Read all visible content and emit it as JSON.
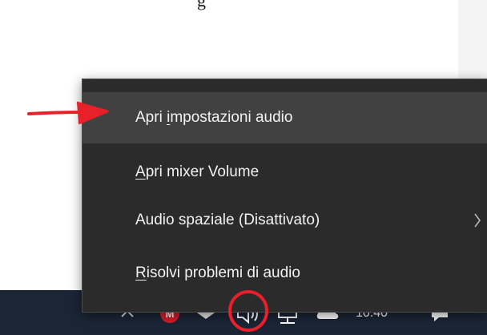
{
  "menu": {
    "items": [
      {
        "pre": "Apri ",
        "accel": "i",
        "post": "mpostazioni audio",
        "has_submenu": false,
        "highlighted": true
      },
      {
        "pre": "",
        "accel": "A",
        "post": "pri mixer Volume",
        "has_submenu": false,
        "highlighted": false
      },
      {
        "pre": "Audio spaziale (Disattivato)",
        "accel": "",
        "post": "",
        "has_submenu": true,
        "highlighted": false
      },
      {
        "pre": "",
        "accel": "R",
        "post": "isolvi problemi di audio",
        "has_submenu": false,
        "highlighted": false
      }
    ]
  },
  "taskbar": {
    "time_fragment": "10:40",
    "tray_icons": [
      "chevron-up-icon",
      "app-badge-icon",
      "dropbox-icon",
      "speaker-icon",
      "network-icon",
      "onedrive-icon",
      "notification-icon"
    ]
  },
  "annotations": {
    "arrow_color": "#e8202a",
    "circle_color": "#e8202a"
  },
  "colors": {
    "menu_bg": "#2b2b2b",
    "menu_highlight": "#414141",
    "menu_text": "#f2f2f2",
    "taskbar_bg": "#1b2535"
  }
}
